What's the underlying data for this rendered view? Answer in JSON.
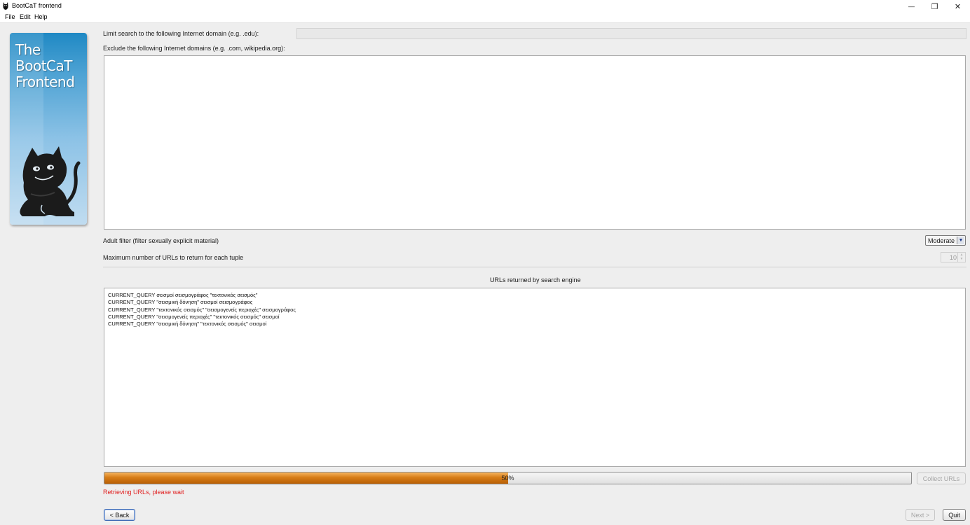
{
  "window": {
    "title": "BootCaT frontend",
    "minimize_glyph": "—",
    "restore_glyph": "❐",
    "close_glyph": "✕"
  },
  "menu": [
    "File",
    "Edit",
    "Help"
  ],
  "logo": {
    "lines": [
      "The",
      "BootCaT",
      "Frontend"
    ]
  },
  "form": {
    "limit_domain_label": "Limit search to the following Internet domain (e.g. .edu):",
    "limit_domain_value": "",
    "exclude_domains_label": "Exclude the following Internet domains (e.g. .com, wikipedia.org):",
    "exclude_domains_value": "",
    "adult_filter_label": "Adult filter (filter sexually explicit material)",
    "adult_filter_value": "Moderate",
    "max_urls_label": "Maximum number of URLs to return for each tuple",
    "max_urls_value": "10"
  },
  "results": {
    "heading": "URLs returned by search engine",
    "lines": [
      "CURRENT_QUERY σεισμοί σεισμογράφος \"τεκτονικός σεισμός\"",
      "CURRENT_QUERY \"σεισμική δόνηση\" σεισμοί σεισμογράφος",
      "CURRENT_QUERY \"τεκτονικός σεισμός\" \"σεισμογενείς περιοχές\" σεισμογράφος",
      "CURRENT_QUERY \"σεισμογενείς περιοχές\" \"τεκτονικός σεισμός\" σεισμοί",
      "CURRENT_QUERY \"σεισμική δόνηση\" \"τεκτονικός σεισμός\" σεισμοί"
    ]
  },
  "progress": {
    "percent": 50,
    "label": "50%"
  },
  "buttons": {
    "collect": "Collect URLs",
    "back": "< Back",
    "next": "Next >",
    "quit": "Quit"
  },
  "status": "Retrieving URLs, please wait",
  "colors": {
    "status": "#e02020",
    "progress_fill": "#d67c16",
    "logo_blue": "#1f89c4"
  }
}
